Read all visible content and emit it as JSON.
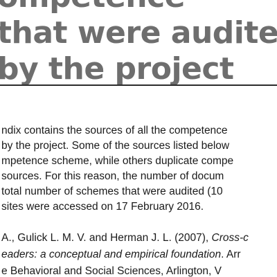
{
  "heading": {
    "lines": [
      "ompetence",
      "that were audited",
      "by the project"
    ]
  },
  "body": {
    "lines": [
      "ndix contains the sources of all the competence",
      "by the project. Some of the sources listed below",
      "mpetence scheme, while others duplicate compe",
      "sources. For this reason, the number of docum",
      "total number of schemes that were audited (10",
      "sites were accessed on 17 February 2016."
    ]
  },
  "reference": {
    "authors": "A., Gulick L. M. V. and Herman J. L. (2007), ",
    "title_part1": "Cross-c",
    "title_part2": "eaders: a conceptual and empirical foundation",
    "after_title": ". Arr",
    "line3": "e Behavioral and Social Sciences, Arlington, V"
  }
}
